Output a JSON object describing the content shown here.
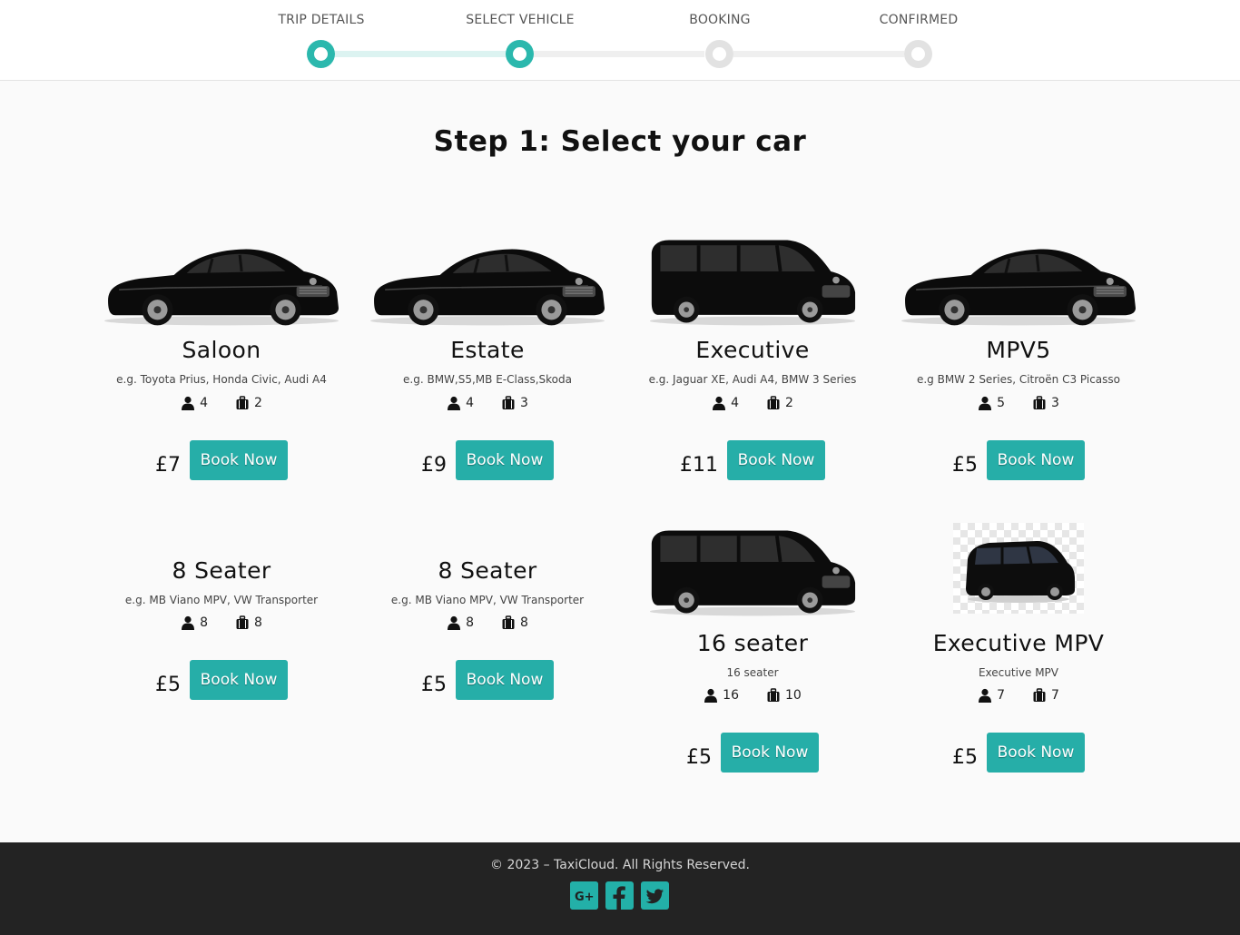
{
  "stepper": {
    "steps": [
      {
        "label": "TRIP DETAILS"
      },
      {
        "label": "SELECT VEHICLE"
      },
      {
        "label": "BOOKING"
      },
      {
        "label": "CONFIRMED"
      }
    ],
    "completed_steps": 2
  },
  "main": {
    "title": "Step 1: Select your car"
  },
  "book_label": "Book Now",
  "cars": [
    {
      "name": "Saloon",
      "desc": "e.g. Toyota Prius, Honda Civic, Audi A4",
      "passengers": "4",
      "luggage": "2",
      "price": "£7",
      "image": "sedan-icon"
    },
    {
      "name": "Estate",
      "desc": "e.g. BMW,S5,MB E-Class,Skoda",
      "passengers": "4",
      "luggage": "3",
      "price": "£9",
      "image": "sedan-icon"
    },
    {
      "name": "Executive",
      "desc": "e.g. Jaguar XE, Audi A4, BMW 3 Series",
      "passengers": "4",
      "luggage": "2",
      "price": "£11",
      "image": "van-icon"
    },
    {
      "name": "MPV5",
      "desc": "e.g BMW 2 Series, Citroën C3 Picasso",
      "passengers": "5",
      "luggage": "3",
      "price": "£5",
      "image": "sedan-icon"
    },
    {
      "name": "8 Seater",
      "desc": "e.g. MB Viano MPV, VW Transporter",
      "passengers": "8",
      "luggage": "8",
      "price": "£5",
      "image": ""
    },
    {
      "name": "8 Seater",
      "desc": "e.g. MB Viano MPV, VW Transporter",
      "passengers": "8",
      "luggage": "8",
      "price": "£5",
      "image": ""
    },
    {
      "name": "16 seater",
      "desc": "16 seater",
      "passengers": "16",
      "luggage": "10",
      "price": "£5",
      "image": "van-icon"
    },
    {
      "name": "Executive MPV",
      "desc": "Executive MPV",
      "passengers": "7",
      "luggage": "7",
      "price": "£5",
      "image": "minivan-icon"
    }
  ],
  "footer": {
    "copyright": "© 2023 – TaxiCloud. All Rights Reserved.",
    "social": [
      "google-plus-icon",
      "facebook-icon",
      "twitter-icon"
    ]
  },
  "colors": {
    "accent": "#26aea8",
    "footer_bg": "#232323"
  }
}
